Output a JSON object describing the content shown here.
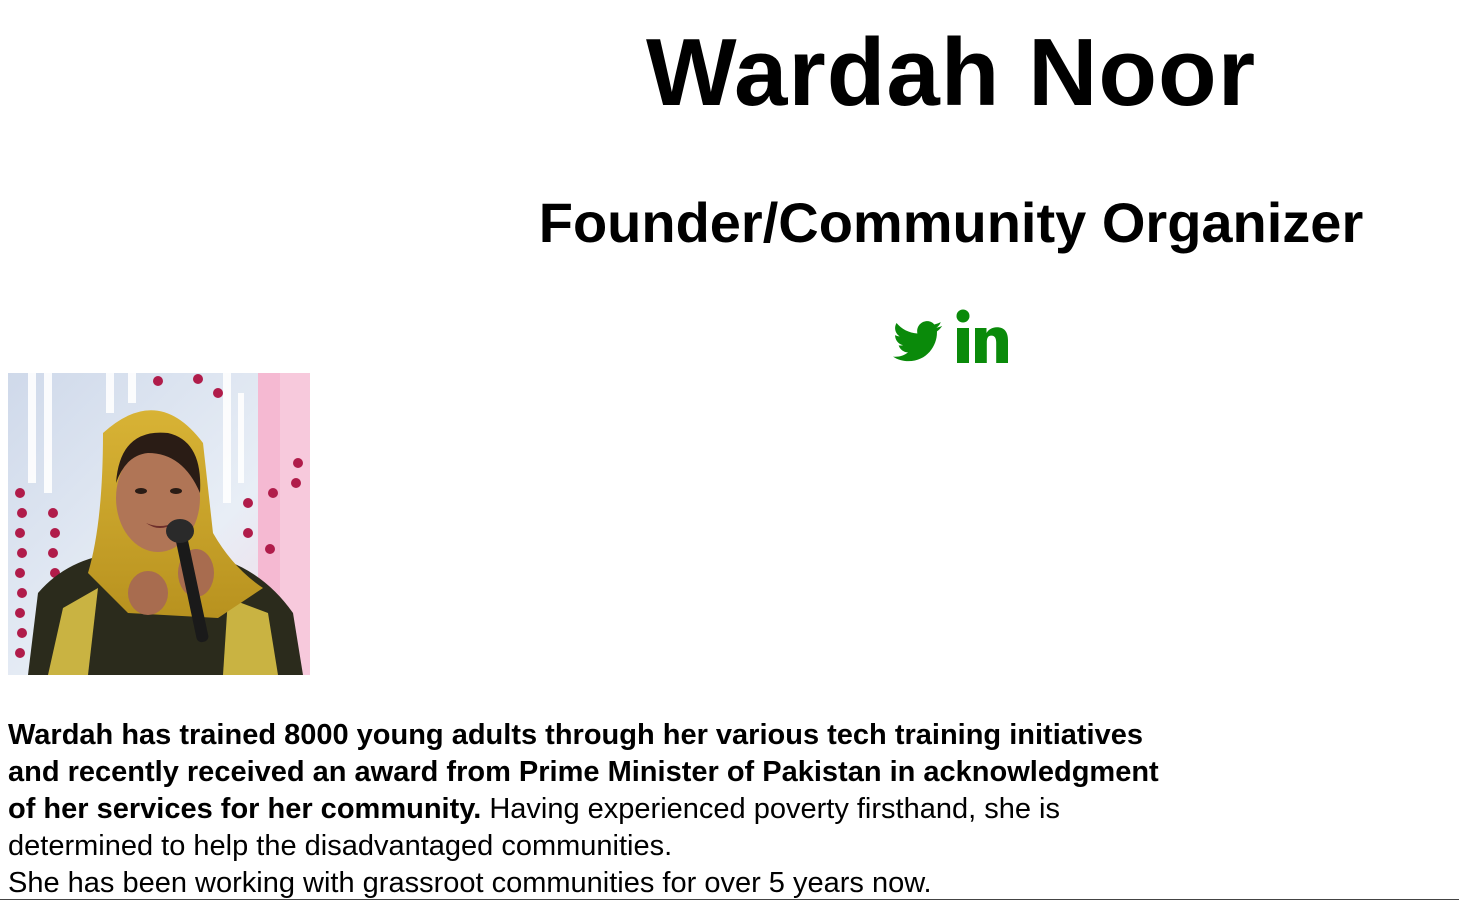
{
  "profile": {
    "name": "Wardah Noor",
    "role": "Founder/Community Organizer",
    "photo_alt": "Wardah Noor speaking into a microphone"
  },
  "social": {
    "links": [
      {
        "icon": "twitter-icon",
        "label": "Twitter"
      },
      {
        "icon": "linkedin-icon",
        "label": "LinkedIn"
      }
    ],
    "color": "#0a8a0a"
  },
  "bio": {
    "bold": "Wardah has trained 8000 young adults through her various tech training initiatives and recently received an award from Prime Minister of Pakistan in acknowledgment of her services for her community.",
    "regular_1": " Having experienced poverty firsthand, she is determined to help the disadvantaged communities.",
    "regular_2": "She has been working with grassroot communities for over 5 years now."
  }
}
